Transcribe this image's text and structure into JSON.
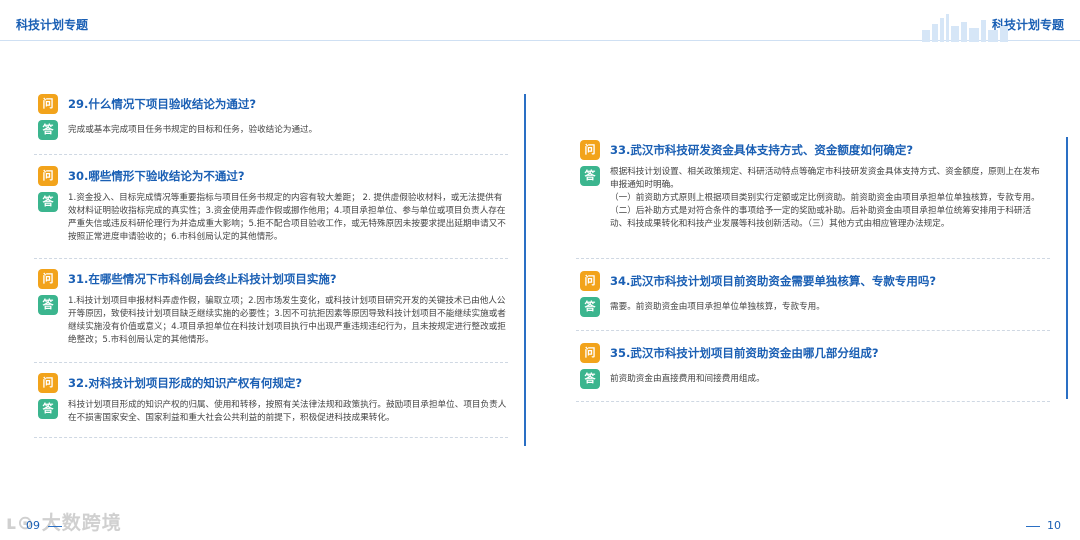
{
  "header": {
    "left_title": "科技计划专题",
    "right_title": "科技计划专题"
  },
  "badges": {
    "question": "问",
    "answer": "答"
  },
  "left_items": [
    {
      "question": "29.什么情况下项目验收结论为通过?",
      "answer": "完成或基本完成项目任务书规定的目标和任务，验收结论为通过。"
    },
    {
      "question": "30.哪些情形下验收结论为不通过?",
      "answer": "1.资金投入、目标完成情况等重要指标与项目任务书规定的内容有较大差距；  2. 提供虚假验收材料，或无法提供有效材料证明验收指标完成的真实性；3.资金使用弄虚作假或挪作他用；4.项目承担单位、参与单位或项目负责人存在严重失信或违反科研伦理行为并造成重大影响；5.拒不配合项目验收工作，或无特殊原因未按要求提出延期申请又不按照正常进度申请验收的；6.市科创局认定的其他情形。"
    },
    {
      "question": "31.在哪些情况下市科创局会终止科技计划项目实施?",
      "answer": "1.科技计划项目申报材料弄虚作假，骗取立项；2.因市场发生变化，或科技计划项目研究开发的关键技术已由他人公开等原因，致使科技计划项目缺乏继续实施的必要性；3.因不可抗拒因素等原因导致科技计划项目不能继续实施或者继续实施没有价值或意义；4.项目承担单位在科技计划项目执行中出现严重违规违纪行为，且未按规定进行整改或拒绝整改；5.市科创局认定的其他情形。"
    },
    {
      "question": "32.对科技计划项目形成的知识产权有何规定?",
      "answer": "科技计划项目形成的知识产权的归属、使用和转移，按照有关法律法规和政策执行。鼓励项目承担单位、项目负责人在不损害国家安全、国家利益和重大社会公共利益的前提下，积极促进科技成果转化。"
    }
  ],
  "right_items": [
    {
      "question": "33.武汉市科技研发资金具体支持方式、资金额度如何确定?",
      "answer": "根据科技计划设置、相关政策规定、科研活动特点等确定市科技研发资金具体支持方式、资金额度，原则上在发布申报通知时明确。\n（一）前资助方式原则上根据项目类别实行定额或定比例资助。前资助资金由项目承担单位单独核算，专款专用。（二）后补助方式是对符合条件的事项给予一定的奖励或补助。后补助资金由项目承担单位统筹安排用于科研活动、科技成果转化和科技产业发展等科技创新活动。（三）其他方式由相应管理办法规定。"
    },
    {
      "question": "34.武汉市科技计划项目前资助资金需要单独核算、专款专用吗?",
      "answer": "需要。前资助资金由项目承担单位单独核算，专款专用。"
    },
    {
      "question": "35.武汉市科技计划项目前资助资金由哪几部分组成?",
      "answer": "前资助资金由直接费用和间接费用组成。"
    }
  ],
  "footer": {
    "left_page": "09",
    "right_page": "10",
    "watermark": "大数跨境"
  }
}
